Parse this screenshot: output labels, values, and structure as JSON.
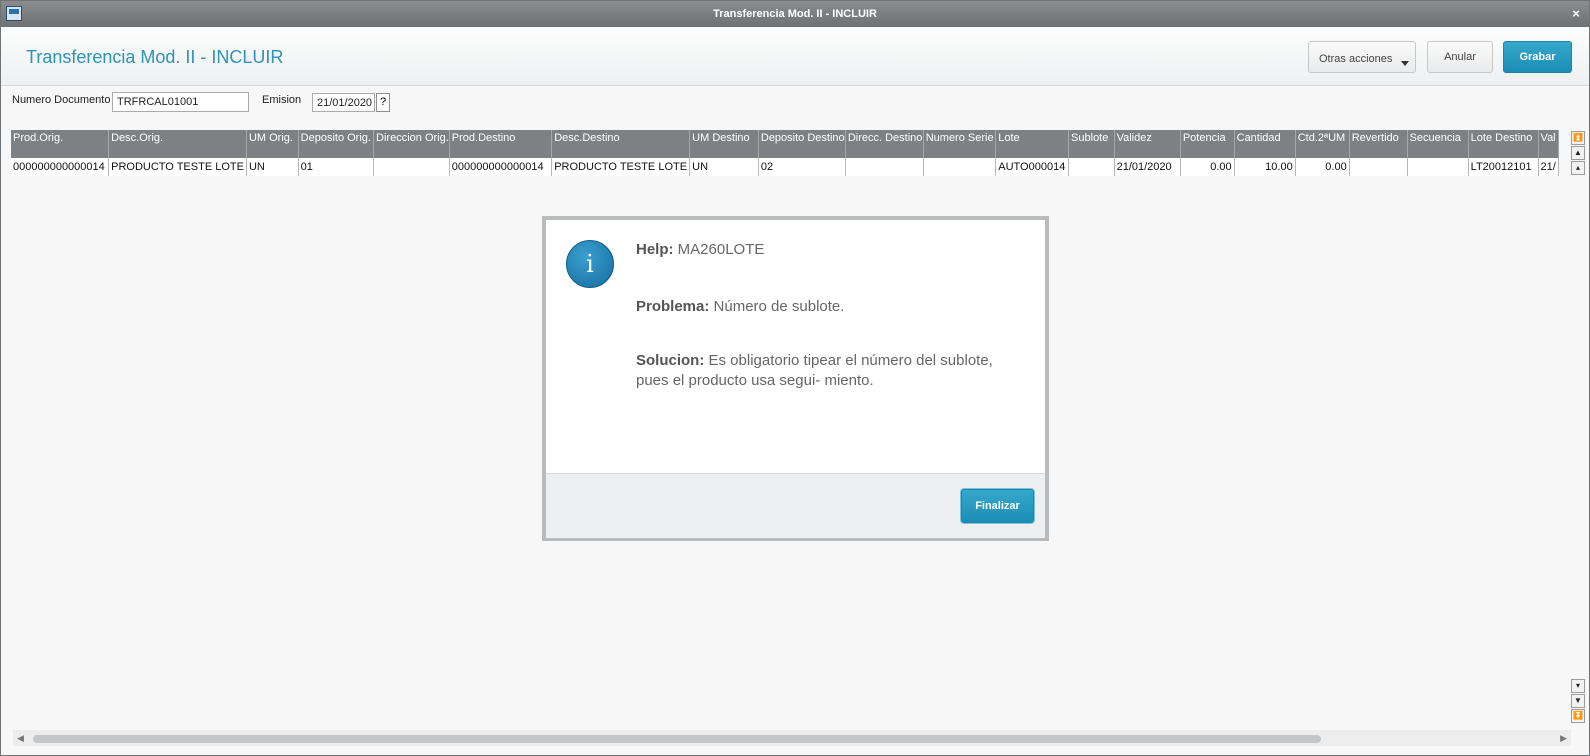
{
  "window": {
    "title": "Transferencia Mod. II - INCLUIR",
    "close_label": "×"
  },
  "header": {
    "title": "Transferencia Mod. II - INCLUIR",
    "other_actions_label": "Otras acciones",
    "cancel_label": "Anular",
    "save_label": "Grabar"
  },
  "form": {
    "doc_label": "Numero Documento",
    "doc_value": "TRFRCAL01001",
    "emission_label": "Emision",
    "emission_value": "21/01/2020",
    "help_label": "?"
  },
  "grid": {
    "columns": [
      "Prod.Orig.",
      "Desc.Orig.",
      "UM Orig.",
      "Deposito Orig.",
      "Direccion Orig.",
      "Prod.Destino",
      "Desc.Destino",
      "UM Destino",
      "Deposito Destino",
      "Direcc. Destino",
      "Numero Serie",
      "Lote",
      "Sublote",
      "Validez",
      "Potencia",
      "Cantidad",
      "Ctd.2ªUM",
      "Revertido",
      "Secuencia",
      "Lote Destino",
      "Val"
    ],
    "rows": [
      [
        "000000000000014",
        "PRODUCTO TESTE LOTE",
        "UN",
        "01",
        "",
        "000000000000014",
        "PRODUCTO TESTE LOTE",
        "UN",
        "02",
        "",
        "",
        "AUTO000014",
        "",
        "21/01/2020",
        "0.00",
        "10.00",
        "0.00",
        "",
        "",
        "LT20012101",
        "21/"
      ]
    ]
  },
  "dialog": {
    "help_label": "Help:",
    "help_value": "MA260LOTE",
    "problem_label": "Problema:",
    "problem_value": "Número de sublote.",
    "solution_label": "Solucion:",
    "solution_line1": "Es obligatorio tipear el número del sublote,",
    "solution_line2": "pues el producto usa segui- miento.",
    "finish_label": "Finalizar",
    "info_glyph": "i"
  }
}
